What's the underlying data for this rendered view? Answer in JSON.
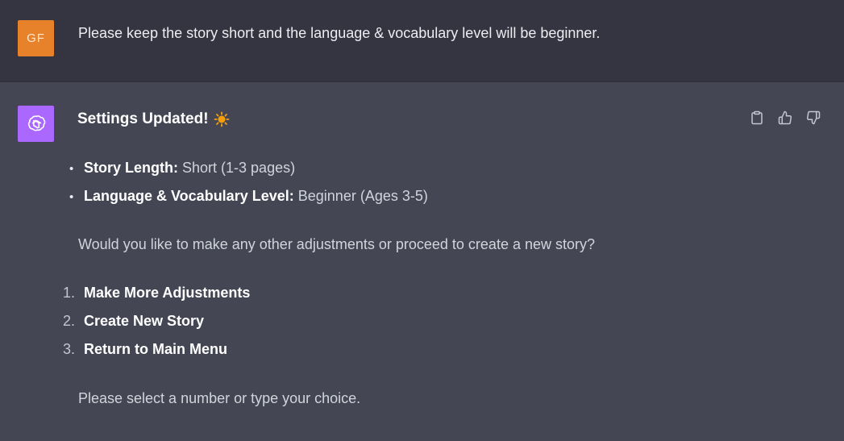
{
  "user": {
    "initials": "GF",
    "message": "Please keep the story short and the language & vocabulary level will be beginner."
  },
  "assistant": {
    "heading": "Settings Updated!",
    "heading_emoji": "sun-icon",
    "bullets": [
      {
        "label": "Story Length:",
        "value": "Short (1-3 pages)"
      },
      {
        "label": "Language & Vocabulary Level:",
        "value": "Beginner (Ages 3-5)"
      }
    ],
    "question": "Would you like to make any other adjustments or proceed to create a new story?",
    "options": [
      {
        "num": "1.",
        "label": "Make More Adjustments"
      },
      {
        "num": "2.",
        "label": "Create New Story"
      },
      {
        "num": "3.",
        "label": "Return to Main Menu"
      }
    ],
    "closing": "Please select a number or type your choice.",
    "actions": [
      "clipboard-icon",
      "thumbs-up-icon",
      "thumbs-down-icon"
    ]
  },
  "colors": {
    "user_bg": "#343541",
    "assistant_bg": "#444654",
    "user_avatar": "#e8822a",
    "bot_avatar": "#ab68ff"
  }
}
